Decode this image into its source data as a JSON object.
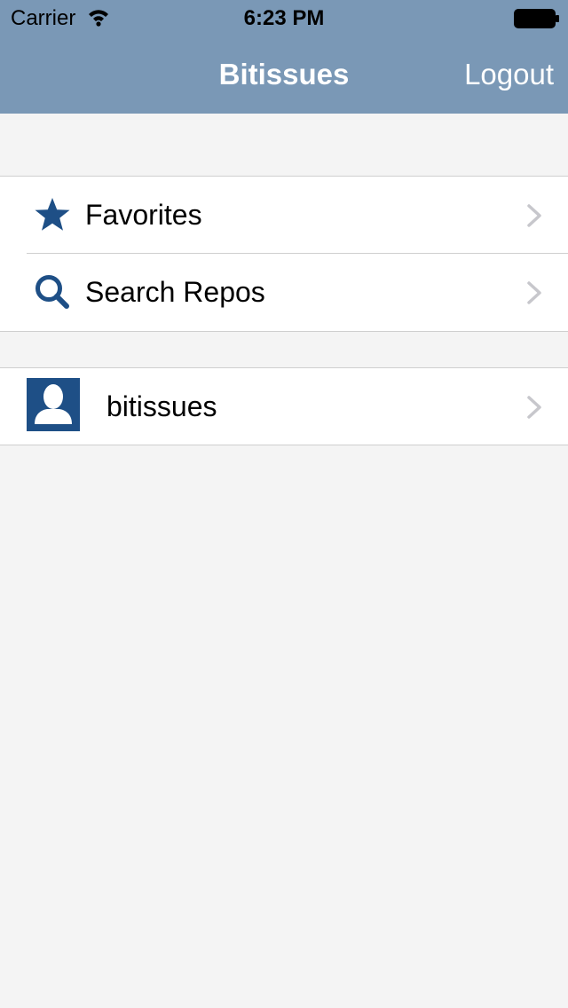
{
  "status_bar": {
    "carrier": "Carrier",
    "time": "6:23 PM",
    "wifi_icon": "wifi-icon",
    "battery_icon": "battery-icon"
  },
  "nav_bar": {
    "title": "Bitissues",
    "logout_label": "Logout",
    "background_color": "#7a98b6"
  },
  "menu": {
    "items": [
      {
        "label": "Favorites",
        "icon": "star-icon"
      },
      {
        "label": "Search Repos",
        "icon": "search-icon"
      }
    ]
  },
  "accounts": {
    "items": [
      {
        "label": "bitissues",
        "icon": "user-avatar"
      }
    ]
  },
  "colors": {
    "accent": "#1e4f86",
    "chevron": "#c7c7cc",
    "background": "#f4f4f4"
  }
}
